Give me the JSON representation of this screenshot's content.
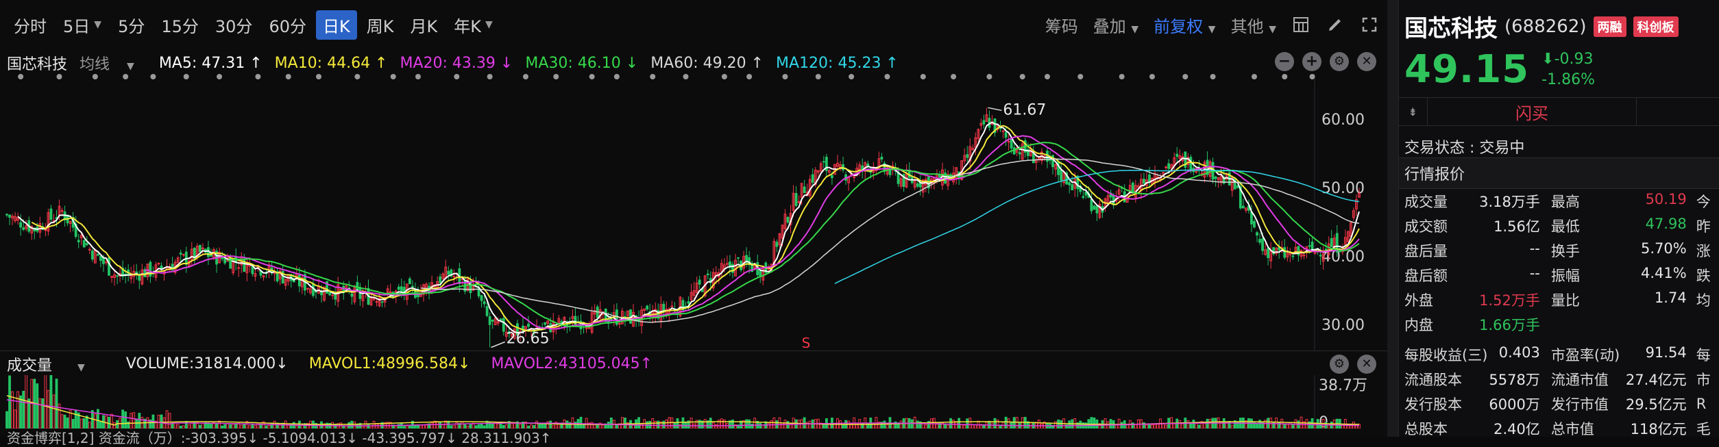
{
  "toolbar": {
    "periods": [
      "分时",
      "5日",
      "5分",
      "15分",
      "30分",
      "60分",
      "日K",
      "周K",
      "月K",
      "年K"
    ],
    "active": "日K",
    "tools": {
      "chips": "筹码",
      "overlay": "叠加",
      "fq": "前复权",
      "other": "其他"
    }
  },
  "stock": {
    "name": "国芯科技",
    "code": "(688262)",
    "tag1": "两融",
    "tag2": "科创板",
    "price": "49.15",
    "change": "-0.93",
    "change_pct": "-1.86%",
    "trade_button": "闪买"
  },
  "chart": {
    "main_label": "国芯科技",
    "ma_label": "均线",
    "ma": [
      {
        "text": "MA5: 47.31 ↑",
        "color": "#ffffff"
      },
      {
        "text": "MA10: 44.64 ↑",
        "color": "#f5e93a"
      },
      {
        "text": "MA20: 43.39 ↓",
        "color": "#e23de6"
      },
      {
        "text": "MA30: 46.10 ↓",
        "color": "#36d84a"
      },
      {
        "text": "MA60: 49.20 ↑",
        "color": "#d8d8d8"
      },
      {
        "text": "MA120: 45.23 ↑",
        "color": "#31d8e8"
      }
    ],
    "high_label": "61.67",
    "low_label": "26.65",
    "signal": "S"
  },
  "chart_data": {
    "type": "candlestick",
    "yticks": [
      60.0,
      50.0,
      40.0,
      30.0
    ],
    "y_axis_labels": [
      "60.00",
      "50.00",
      "40.00",
      "30.00"
    ],
    "ylim": [
      27,
      66
    ],
    "anchors_close": [
      [
        0,
        46
      ],
      [
        10,
        44
      ],
      [
        20,
        46.5
      ],
      [
        30,
        41
      ],
      [
        40,
        37
      ],
      [
        55,
        38
      ],
      [
        70,
        40.5
      ],
      [
        90,
        38.5
      ],
      [
        110,
        35.5
      ],
      [
        130,
        34
      ],
      [
        150,
        35
      ],
      [
        160,
        37.5
      ],
      [
        170,
        35
      ],
      [
        175,
        30
      ],
      [
        185,
        29
      ],
      [
        200,
        30
      ],
      [
        215,
        31
      ],
      [
        230,
        31
      ],
      [
        245,
        33
      ],
      [
        255,
        37
      ],
      [
        265,
        39
      ],
      [
        275,
        38
      ],
      [
        285,
        48
      ],
      [
        295,
        53
      ],
      [
        305,
        52
      ],
      [
        315,
        53.5
      ],
      [
        325,
        51
      ],
      [
        335,
        51
      ],
      [
        345,
        52
      ],
      [
        355,
        60
      ],
      [
        365,
        56
      ],
      [
        375,
        54
      ],
      [
        385,
        51
      ],
      [
        395,
        47
      ],
      [
        405,
        49
      ],
      [
        415,
        52
      ],
      [
        425,
        54
      ],
      [
        435,
        53
      ],
      [
        445,
        50
      ],
      [
        455,
        41
      ],
      [
        465,
        40
      ],
      [
        475,
        41
      ],
      [
        485,
        42
      ],
      [
        490,
        49.15
      ]
    ],
    "volume": {
      "label": "成交量",
      "value_text": "VOLUME:31814.000↓",
      "mavol1": "MAVOL1:48996.584↓",
      "mavol2": "MAVOL2:43105.045↑",
      "y_top": "38.7万",
      "y_bottom": "0"
    }
  },
  "indicator_text": "资金博弈[1,2]  资金流（万）:-303.395↓  -5.1094.013↓  -43.395.797↓  28.311.903↑",
  "status": "交易状态 : 交易中",
  "quote_title": "行情报价",
  "quotes": [
    {
      "l1": "成交量",
      "v1": "3.18万手",
      "l2": "最高",
      "v2": "50.19",
      "v2c": "red",
      "l3": "今"
    },
    {
      "l1": "成交额",
      "v1": "1.56亿",
      "l2": "最低",
      "v2": "47.98",
      "v2c": "green",
      "l3": "昨"
    },
    {
      "l1": "盘后量",
      "v1": "--",
      "l2": "换手",
      "v2": "5.70%",
      "v2c": "",
      "l3": "涨"
    },
    {
      "l1": "盘后额",
      "v1": "--",
      "l2": "振幅",
      "v2": "4.41%",
      "v2c": "",
      "l3": "跌"
    },
    {
      "l1": "外盘",
      "v1": "1.52万手",
      "v1c": "red",
      "l2": "量比",
      "v2": "1.74",
      "v2c": "",
      "l3": "均"
    },
    {
      "l1": "内盘",
      "v1": "1.66万手",
      "v1c": "green",
      "l2": "",
      "v2": "",
      "v2c": "",
      "l3": ""
    },
    {
      "l1": "每股收益(三)",
      "v1": "0.403",
      "l2": "市盈率(动)",
      "v2": "91.54",
      "v2c": "",
      "l3": "每"
    },
    {
      "l1": "流通股本",
      "v1": "5578万",
      "l2": "流通市值",
      "v2": "27.4亿元",
      "v2c": "",
      "l3": "市"
    },
    {
      "l1": "发行股本",
      "v1": "6000万",
      "l2": "发行市值",
      "v2": "29.5亿元",
      "v2c": "",
      "l3": "R"
    },
    {
      "l1": "总股本",
      "v1": "2.40亿",
      "l2": "总市值",
      "v2": "118亿元",
      "v2c": "",
      "l3": "毛"
    }
  ]
}
